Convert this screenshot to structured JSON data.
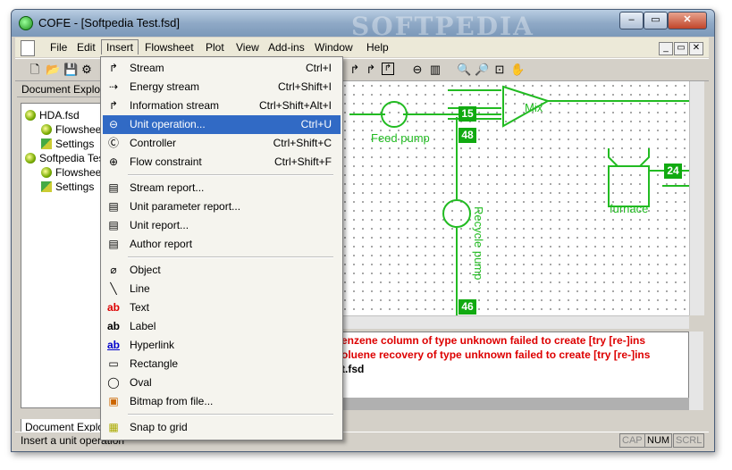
{
  "window": {
    "title": "COFE - [Softpedia Test.fsd]",
    "watermark": "SOFTPEDIA",
    "controls": [
      "–",
      "▭",
      "✕"
    ]
  },
  "menubar": {
    "items": [
      "File",
      "Edit",
      "Insert",
      "Flowsheet",
      "Plot",
      "View",
      "Add-ins",
      "Window",
      "Help"
    ],
    "open": "Insert",
    "mdi_controls": [
      "_",
      "▭",
      "✕"
    ]
  },
  "left_pane": {
    "header": "Document Explorer",
    "tree": [
      {
        "label": "HDA.fsd"
      },
      {
        "label": "Flowsheet"
      },
      {
        "label": "Settings"
      },
      {
        "label": "Softpedia Test.fsd"
      },
      {
        "label": "Flowsheet"
      },
      {
        "label": "Settings"
      }
    ],
    "bottom_tab": "Document Explorer"
  },
  "insert_menu": {
    "items": [
      {
        "label": "Stream",
        "shortcut": "Ctrl+I",
        "icon": "stream-icon",
        "glyph": "↱"
      },
      {
        "label": "Energy stream",
        "shortcut": "Ctrl+Shift+I",
        "icon": "energy-stream-icon",
        "glyph": "⇢"
      },
      {
        "label": "Information stream",
        "shortcut": "Ctrl+Shift+Alt+I",
        "icon": "information-stream-icon",
        "glyph": "↱"
      },
      {
        "label": "Unit operation...",
        "shortcut": "Ctrl+U",
        "icon": "unit-operation-icon",
        "glyph": "⊖"
      },
      {
        "label": "Controller",
        "shortcut": "Ctrl+Shift+C",
        "icon": "controller-icon",
        "glyph": "Ⓒ"
      },
      {
        "label": "Flow constraint",
        "shortcut": "Ctrl+Shift+F",
        "icon": "flow-constraint-icon",
        "glyph": "⊕"
      },
      {
        "label": "Stream report...",
        "shortcut": "",
        "icon": "stream-report-icon",
        "glyph": "▤"
      },
      {
        "label": "Unit parameter report...",
        "shortcut": "",
        "icon": "unit-parameter-report-icon",
        "glyph": "▤"
      },
      {
        "label": "Unit report...",
        "shortcut": "",
        "icon": "unit-report-icon",
        "glyph": "▤"
      },
      {
        "label": "Author report",
        "shortcut": "",
        "icon": "author-report-icon",
        "glyph": "▤"
      },
      {
        "label": "Object",
        "shortcut": "",
        "icon": "paperclip-icon",
        "glyph": "⌀"
      },
      {
        "label": "Line",
        "shortcut": "",
        "icon": "line-icon",
        "glyph": "╲"
      },
      {
        "label": "Text",
        "shortcut": "",
        "icon": "text-icon",
        "glyph": "ab"
      },
      {
        "label": "Label",
        "shortcut": "",
        "icon": "label-icon",
        "glyph": "ab"
      },
      {
        "label": "Hyperlink",
        "shortcut": "",
        "icon": "hyperlink-icon",
        "glyph": "ab"
      },
      {
        "label": "Rectangle",
        "shortcut": "",
        "icon": "rectangle-icon",
        "glyph": "▭"
      },
      {
        "label": "Oval",
        "shortcut": "",
        "icon": "oval-icon",
        "glyph": "◯"
      },
      {
        "label": "Bitmap from file...",
        "shortcut": "",
        "icon": "bitmap-icon",
        "glyph": "▣"
      },
      {
        "label": "Snap to grid",
        "shortcut": "",
        "icon": "grid-icon",
        "glyph": "▦"
      }
    ],
    "highlight_color": "#316ac5"
  },
  "flowsheet": {
    "labels": {
      "feed_pump": "Feed pump",
      "recycle_pump": "Recycle pump",
      "mix": "Mix",
      "furnace": "furnace"
    },
    "stream_numbers": [
      "15",
      "48",
      "24",
      "46"
    ],
    "color": "#22bb22"
  },
  "log": {
    "lines": [
      {
        "text": "enzene column of type unknown failed to create [try [re-]ins",
        "color": "#dd0000"
      },
      {
        "text": "oluene recovery of type unknown failed to create [try [re-]ins",
        "color": "#dd0000"
      },
      {
        "text": "t.fsd",
        "color": "#000000"
      }
    ]
  },
  "statusbar": {
    "text": "Insert a unit operation",
    "indicators": [
      {
        "label": "CAP",
        "on": false
      },
      {
        "label": "NUM",
        "on": true
      },
      {
        "label": "SCRL",
        "on": false
      }
    ]
  }
}
